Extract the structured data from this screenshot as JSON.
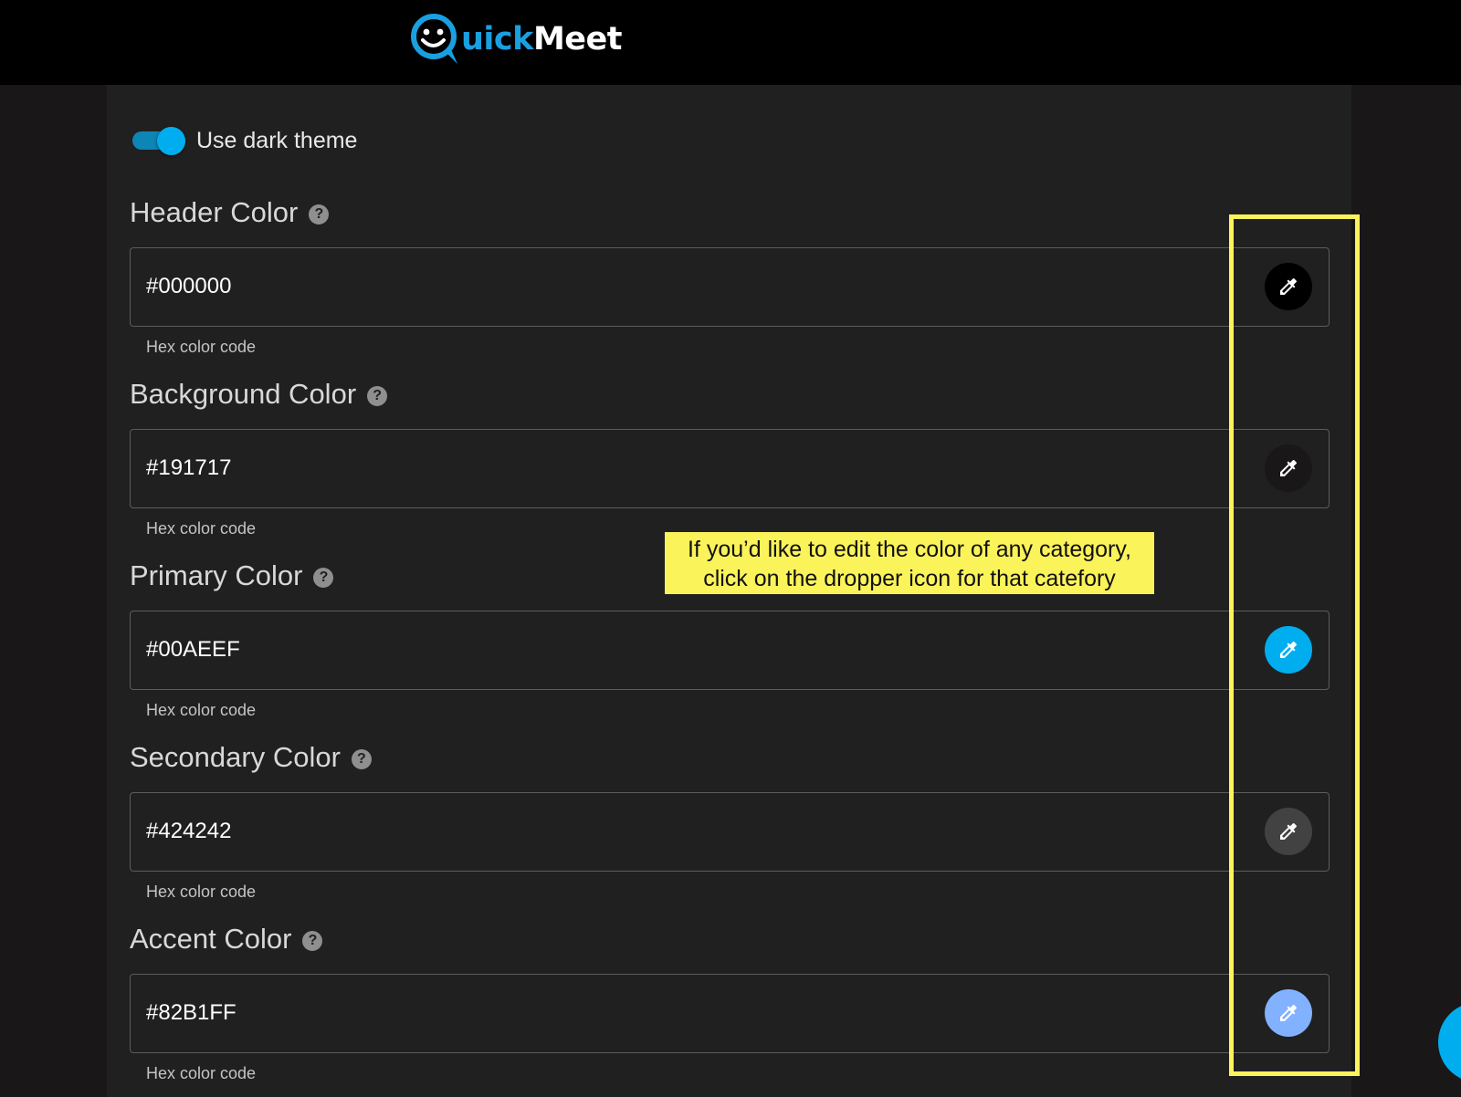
{
  "header": {
    "logo_text_accent": "uick",
    "logo_text_main": "Meet",
    "logo_alt": "QuickMeet"
  },
  "settings": {
    "dark_theme": {
      "label": "Use dark theme",
      "enabled": true
    },
    "colors": [
      {
        "title": "Header Color",
        "value": "#000000",
        "helper": "Hex color code",
        "swatch": "#000000"
      },
      {
        "title": "Background Color",
        "value": "#191717",
        "helper": "Hex color code",
        "swatch": "#191717"
      },
      {
        "title": "Primary Color",
        "value": "#00AEEF",
        "helper": "Hex color code",
        "swatch": "#00AEEF"
      },
      {
        "title": "Secondary Color",
        "value": "#424242",
        "helper": "Hex color code",
        "swatch": "#424242"
      },
      {
        "title": "Accent Color",
        "value": "#82B1FF",
        "helper": "Hex color code",
        "swatch": "#82B1FF"
      }
    ]
  },
  "annotation": {
    "line1": "If you’d like to edit the color of any category,",
    "line2": "click on the dropper icon for that catefory"
  },
  "theme": {
    "brand_blue": "#1a9fe0",
    "highlight_yellow": "#fbf35a"
  }
}
